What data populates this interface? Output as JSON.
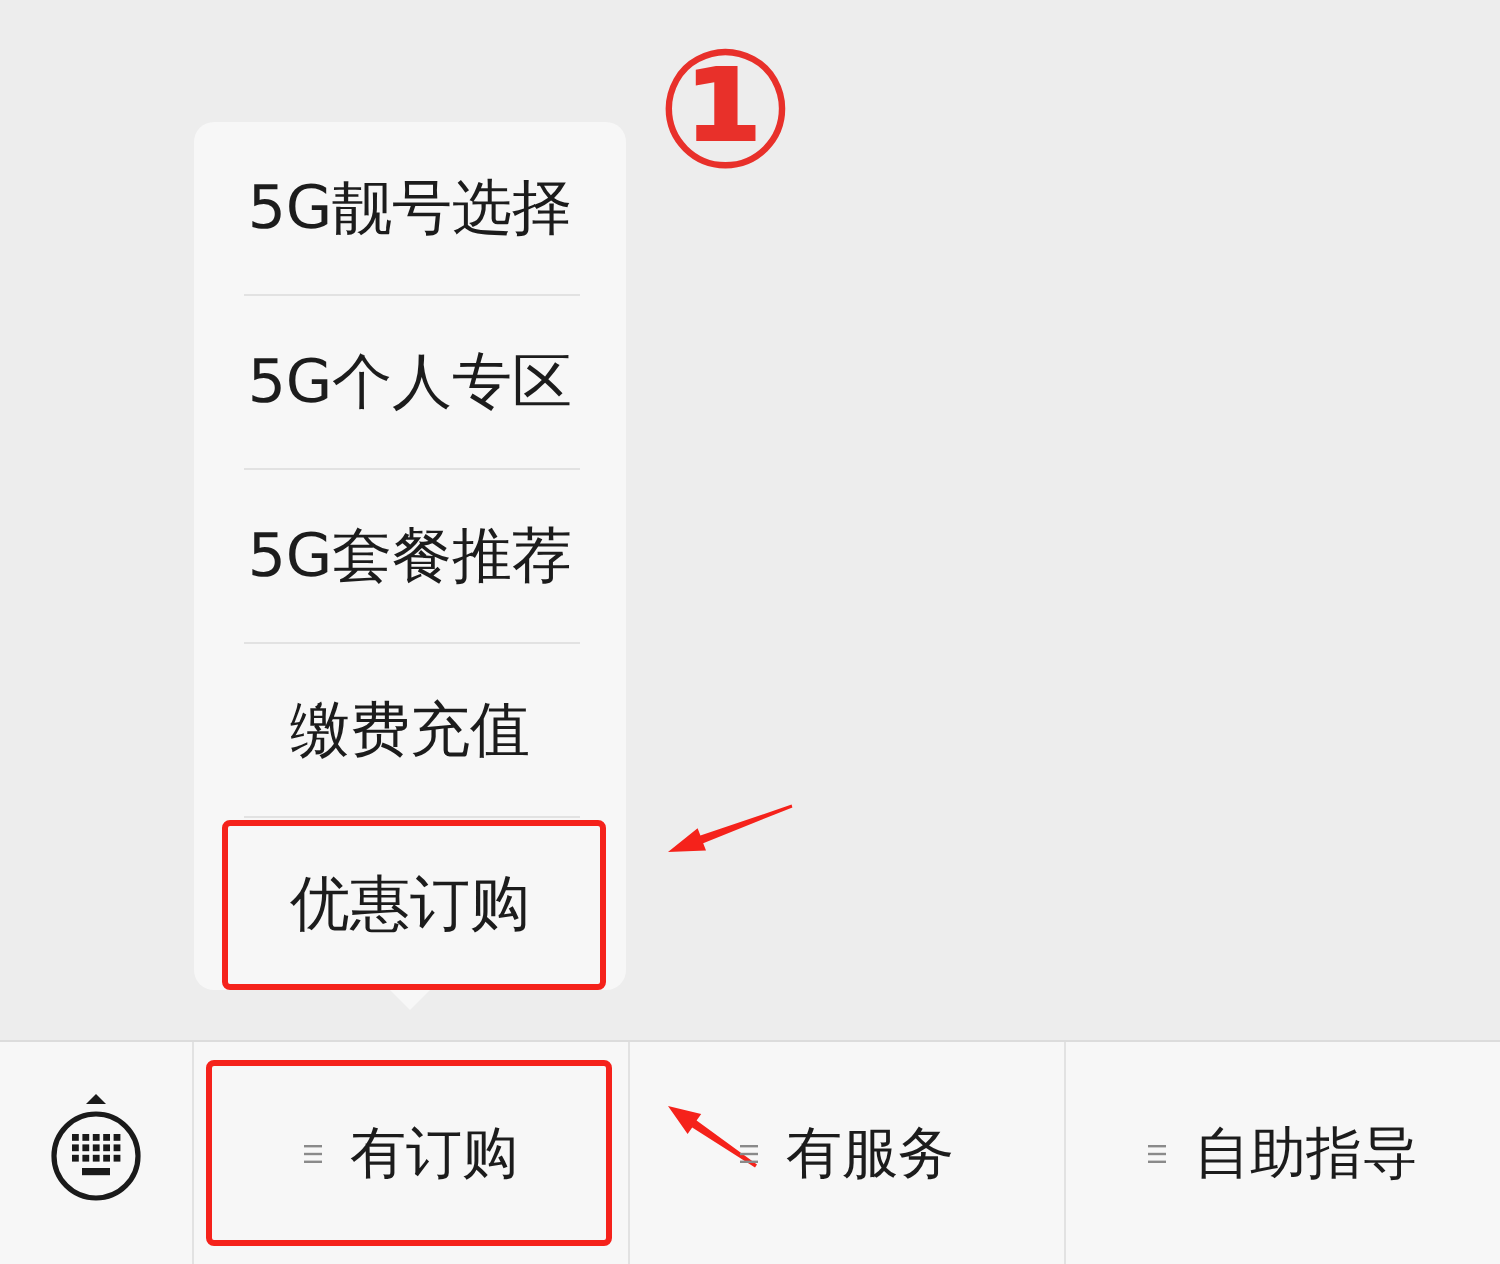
{
  "annotation": {
    "label": "①"
  },
  "tabs": [
    {
      "label": "有订购",
      "highlighted": true,
      "submenu": [
        {
          "label": "5G靓号选择",
          "highlighted": false
        },
        {
          "label": "5G个人专区",
          "highlighted": false
        },
        {
          "label": "5G套餐推荐",
          "highlighted": false
        },
        {
          "label": "缴费充值",
          "highlighted": false
        },
        {
          "label": "优惠订购",
          "highlighted": true
        }
      ]
    },
    {
      "label": "有服务",
      "highlighted": false
    },
    {
      "label": "自助指导",
      "highlighted": false
    }
  ]
}
